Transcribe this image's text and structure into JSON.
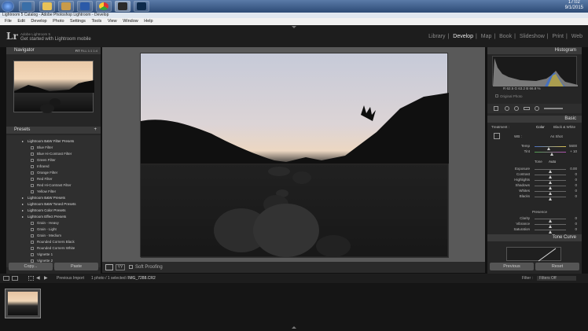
{
  "taskbar": {
    "clock_time": "17:02",
    "clock_date": "9/1/2015",
    "apps": [
      "start",
      "photoshop-taskbar",
      "folder",
      "word",
      "chrome",
      "lightroom-taskbar",
      "photoshop-ps"
    ]
  },
  "window": {
    "title": "Lightroom 5 Catalog - Adobe Photoshop Lightroom - Develop"
  },
  "menu": [
    "File",
    "Edit",
    "Develop",
    "Photo",
    "Settings",
    "Tools",
    "View",
    "Window",
    "Help"
  ],
  "identity": {
    "logo": "Lr",
    "catalog": "Adobe Lightroom 5",
    "mobile": "Get started with Lightroom mobile"
  },
  "modules": [
    {
      "label": "Library",
      "active": false
    },
    {
      "label": "Develop",
      "active": true
    },
    {
      "label": "Map",
      "active": false
    },
    {
      "label": "Book",
      "active": false
    },
    {
      "label": "Slideshow",
      "active": false
    },
    {
      "label": "Print",
      "active": false
    },
    {
      "label": "Web",
      "active": false
    }
  ],
  "left_panel": {
    "navigator_title": "Navigator",
    "navigator_zoom": [
      "FIT",
      "FILL",
      "1:1",
      "1:4"
    ],
    "presets_title": "Presets",
    "presets": [
      {
        "label": "Lightroom B&W Filter Presets",
        "folder": true
      },
      {
        "label": "Blue Filter",
        "folder": false
      },
      {
        "label": "Blue Hi-Contrast Filter",
        "folder": false
      },
      {
        "label": "Green Filter",
        "folder": false
      },
      {
        "label": "Infrared",
        "folder": false
      },
      {
        "label": "Orange Filter",
        "folder": false
      },
      {
        "label": "Red Filter",
        "folder": false
      },
      {
        "label": "Red Hi-Contrast Filter",
        "folder": false
      },
      {
        "label": "Yellow Filter",
        "folder": false
      },
      {
        "label": "Lightroom B&W Presets",
        "folder": true
      },
      {
        "label": "Lightroom B&W Toned Presets",
        "folder": true
      },
      {
        "label": "Lightroom Color Presets",
        "folder": true
      },
      {
        "label": "Lightroom Effect Presets",
        "folder": true
      },
      {
        "label": "Grain - Heavy",
        "folder": false
      },
      {
        "label": "Grain - Light",
        "folder": false
      },
      {
        "label": "Grain - Medium",
        "folder": false
      },
      {
        "label": "Rounded Corners Black",
        "folder": false
      },
      {
        "label": "Rounded Corners White",
        "folder": false
      },
      {
        "label": "Vignette 1",
        "folder": false
      },
      {
        "label": "Vignette 2",
        "folder": false
      }
    ],
    "copy_label": "Copy...",
    "paste_label": "Paste"
  },
  "toolbar": {
    "soft_proofing": "Soft Proofing"
  },
  "right_panel": {
    "histogram_title": "Histogram",
    "readout": "R  62.5   G  63.2   B  66.8  %",
    "original_photo": "Original Photo",
    "basic_title": "Basic",
    "treatment_label": "Treatment :",
    "treatment_color": "Color",
    "treatment_bw": "Black & White",
    "wb_label": "WB :",
    "wb_value": "As Shot",
    "temp_label": "Temp",
    "temp_value": "5600",
    "tint_label": "Tint",
    "tint_value": "+ 10",
    "tone_label": "Tone",
    "auto_label": "Auto",
    "tone_rows": [
      {
        "label": "Exposure",
        "value": "0.00",
        "pos": 0.5
      },
      {
        "label": "Contrast",
        "value": "0",
        "pos": 0.5
      },
      {
        "label": "Highlights",
        "value": "0",
        "pos": 0.5
      },
      {
        "label": "Shadows",
        "value": "0",
        "pos": 0.5
      },
      {
        "label": "Whites",
        "value": "0",
        "pos": 0.5
      },
      {
        "label": "Blacks",
        "value": "0",
        "pos": 0.5
      }
    ],
    "presence_label": "Presence",
    "presence_rows": [
      {
        "label": "Clarity",
        "value": "0",
        "pos": 0.5
      },
      {
        "label": "Vibrance",
        "value": "0",
        "pos": 0.5
      },
      {
        "label": "Saturation",
        "value": "0",
        "pos": 0.5
      }
    ],
    "tonecurve_title": "Tone Curve",
    "previous_label": "Previous",
    "reset_label": "Reset"
  },
  "filmstrip": {
    "source": "Previous Import",
    "info": "1 photo / 1 selected /",
    "filename": "IMG_7288.CR2",
    "filter_label": "Filter :",
    "filter_value": "Filters Off"
  }
}
